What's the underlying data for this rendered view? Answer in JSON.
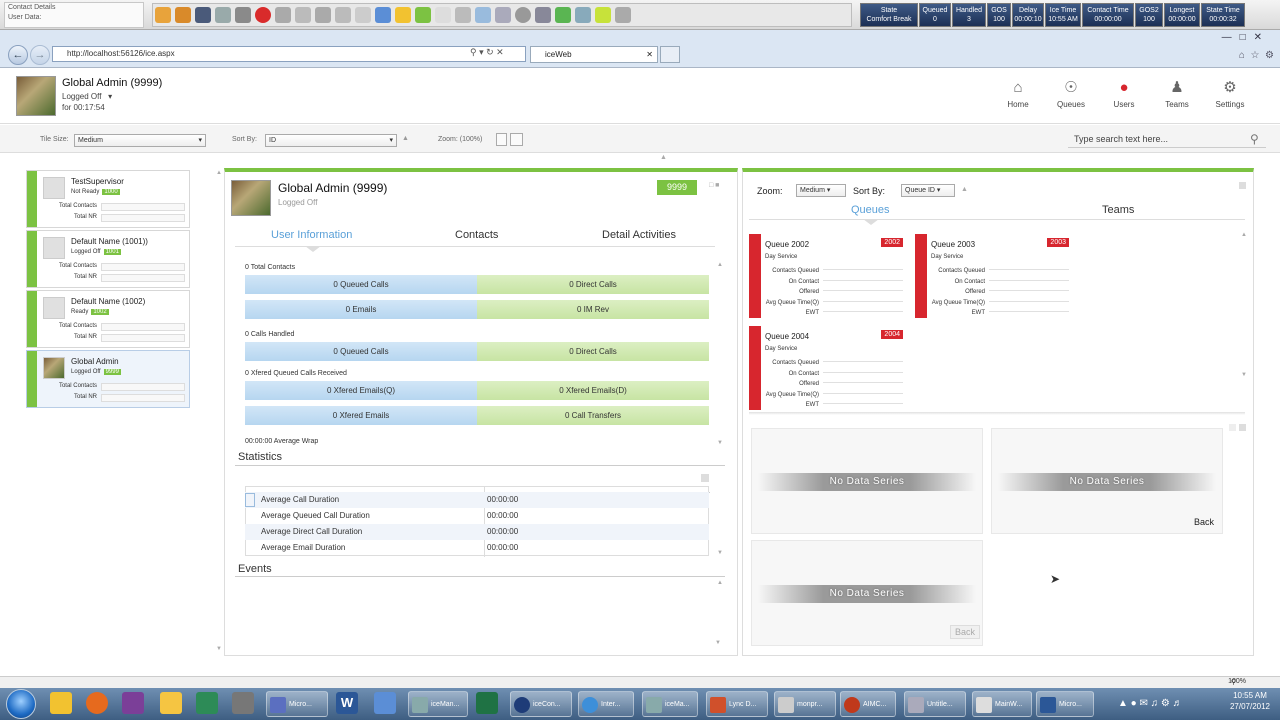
{
  "toolbar": {
    "contact_details": "Contact Details",
    "user_data": "User Data:",
    "stats": [
      {
        "label": "State",
        "value": "Comfort Break"
      },
      {
        "label": "Queued",
        "value": "0"
      },
      {
        "label": "Handled",
        "value": "3"
      },
      {
        "label": "GOS",
        "value": "100"
      },
      {
        "label": "Delay",
        "value": "00:00:10"
      },
      {
        "label": "Ice Time",
        "value": "10:55 AM"
      },
      {
        "label": "Contact Time",
        "value": "00:00:00"
      },
      {
        "label": "GOS2",
        "value": "100"
      },
      {
        "label": "Longest",
        "value": "00:00:00"
      },
      {
        "label": "State Time",
        "value": "00:00:32"
      }
    ]
  },
  "browser": {
    "url": "http://localhost:56126/ice.aspx",
    "tab_title": "iceWeb"
  },
  "header": {
    "user_name": "Global Admin (9999)",
    "status": "Logged Off",
    "timer": "for 00:17:54",
    "nav": [
      {
        "label": "Home",
        "icon": "home-icon"
      },
      {
        "label": "Queues",
        "icon": "queues-icon"
      },
      {
        "label": "Users",
        "icon": "users-icon"
      },
      {
        "label": "Teams",
        "icon": "teams-icon"
      },
      {
        "label": "Settings",
        "icon": "gear-icon"
      }
    ]
  },
  "filters": {
    "tile_size_label": "Tile Size:",
    "tile_size_value": "Medium",
    "sort_by_label": "Sort By:",
    "sort_by_value": "ID",
    "zoom_label": "Zoom: (100%)",
    "search_placeholder": "Type search text here..."
  },
  "agents": [
    {
      "name": "TestSupervisor",
      "state": "Not Ready",
      "id": "1000",
      "total_contacts": "Total Contacts",
      "total_nr": "Total NR"
    },
    {
      "name": "Default Name (1001))",
      "state": "Logged Off",
      "id": "1001",
      "total_contacts": "Total Contacts",
      "total_nr": "Total NR"
    },
    {
      "name": "Default Name (1002)",
      "state": "Ready",
      "id": "1002",
      "total_contacts": "Total Contacts",
      "total_nr": "Total NR"
    },
    {
      "name": "Global Admin",
      "state": "Logged Off",
      "id": "9999",
      "total_contacts": "Total Contacts",
      "total_nr": "Total NR"
    }
  ],
  "detail": {
    "name": "Global Admin (9999)",
    "status": "Logged Off",
    "badge": "9999",
    "tabs": [
      "User Information",
      "Contacts",
      "Detail Activities"
    ],
    "total_contacts": "0 Total Contacts",
    "row1": [
      "0 Queued Calls",
      "0 Direct Calls"
    ],
    "row2": [
      "0 Emails",
      "0 IM Rev"
    ],
    "calls_handled": "0 Calls Handled",
    "row3": [
      "0 Queued Calls",
      "0 Direct Calls"
    ],
    "xfered_label": "0 Xfered Queued Calls Received",
    "row4": [
      "0 Xfered Emails(Q)",
      "0 Xfered Emails(D)"
    ],
    "row5": [
      "0 Xfered Emails",
      "0 Call Transfers"
    ],
    "avg_wrap": "00:00:00 Average Wrap",
    "statistics_title": "Statistics",
    "stats_rows": [
      {
        "label": "Average Call Duration",
        "value": "00:00:00"
      },
      {
        "label": "Average Queued Call Duration",
        "value": "00:00:00"
      },
      {
        "label": "Average Direct Call Duration",
        "value": "00:00:00"
      },
      {
        "label": "Average Email Duration",
        "value": "00:00:00"
      }
    ],
    "events_title": "Events"
  },
  "right": {
    "zoom_label": "Zoom:",
    "zoom_value": "Medium",
    "sort_label": "Sort By:",
    "sort_value": "Queue ID",
    "tabs": [
      "Queues",
      "Teams"
    ],
    "queues": [
      {
        "title": "Queue 2002",
        "badge": "2002",
        "service": "Day Service"
      },
      {
        "title": "Queue 2003",
        "badge": "2003",
        "service": "Day Service"
      },
      {
        "title": "Queue 2004",
        "badge": "2004",
        "service": "Day Service"
      }
    ],
    "queue_fields": [
      "Contacts Queued",
      "On Contact",
      "Offered",
      "Avg Queue Time(Q)",
      "EWT"
    ],
    "no_data": "No Data Series",
    "back": "Back"
  },
  "status_bar": {
    "zoom": "100%"
  },
  "taskbar": {
    "items": [
      "Micro...",
      "iceMan...",
      "iceCon...",
      "Inter...",
      "iceMa...",
      "Lync D...",
      "monpr...",
      "AIMC...",
      "Untitle...",
      "MainW...",
      "Micro..."
    ],
    "time": "10:55 AM",
    "date": "27/07/2012"
  }
}
